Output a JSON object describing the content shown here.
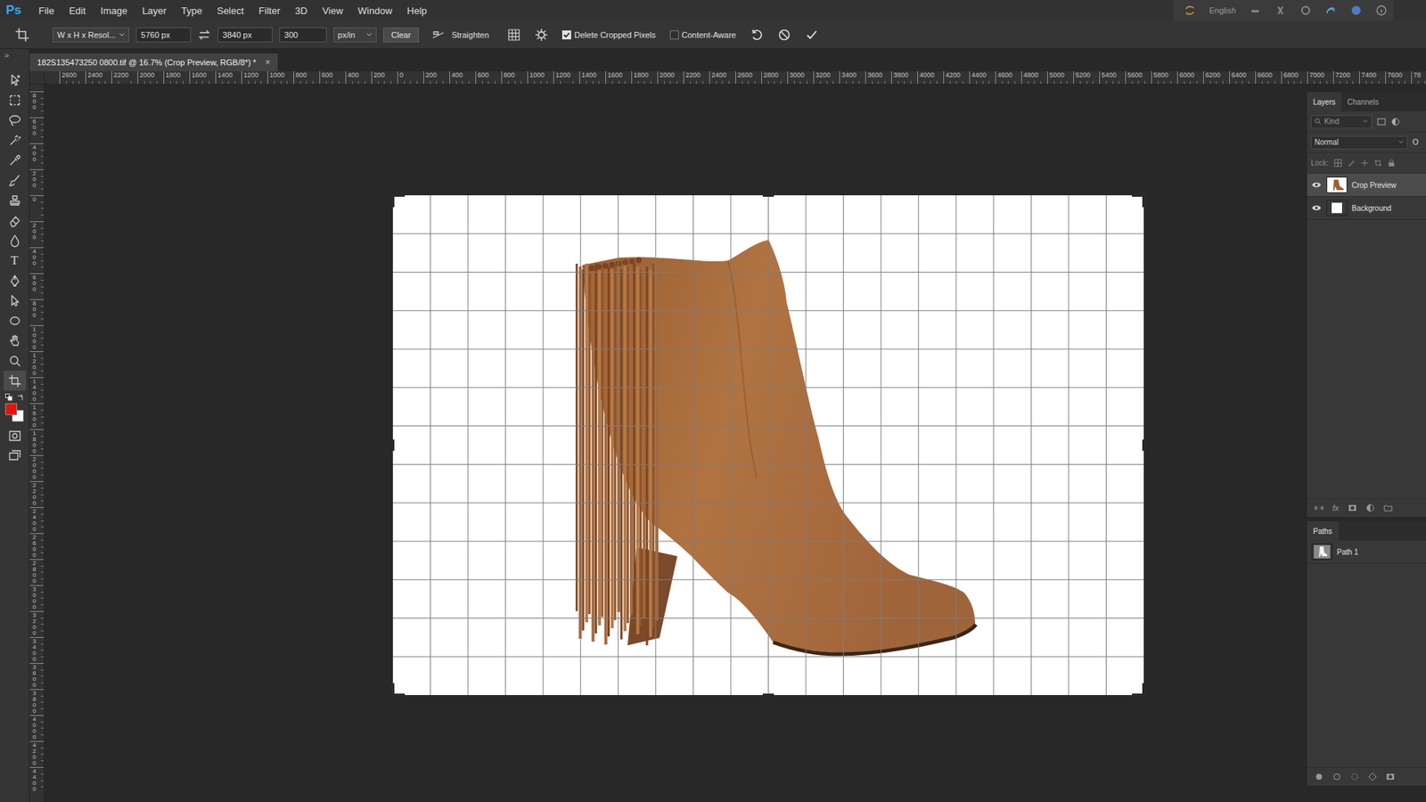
{
  "app": {
    "logo": "Ps"
  },
  "menu": [
    "File",
    "Edit",
    "Image",
    "Layer",
    "Type",
    "Select",
    "Filter",
    "3D",
    "View",
    "Window",
    "Help"
  ],
  "workspace": {
    "language": "English"
  },
  "options": {
    "preset": "W x H x Resol...",
    "width": "5760 px",
    "height": "3840 px",
    "resolution": "300",
    "unit": "px/in",
    "clear": "Clear",
    "straighten": "Straighten",
    "checkboxes": [
      {
        "label": "Delete Cropped Pixels",
        "checked": true
      },
      {
        "label": "Content-Aware",
        "checked": false
      }
    ]
  },
  "document_tab": {
    "title": "182S135473250 0800.tif @ 16.7% (Crop Preview, RGB/8*) *",
    "close": "×",
    "selected": true
  },
  "rulers": {
    "horizontal": [
      "2600",
      "2400",
      "2200",
      "2000",
      "1800",
      "1600",
      "1400",
      "1200",
      "1000",
      "800",
      "600",
      "400",
      "200",
      "0",
      "200",
      "400",
      "600",
      "800",
      "1000",
      "1200",
      "1400",
      "1600",
      "1800",
      "2000",
      "2200",
      "2400",
      "2600",
      "2800",
      "3000",
      "3200",
      "3400",
      "3600",
      "3800",
      "4000",
      "4200",
      "4400",
      "4600",
      "4800",
      "5000",
      "5200",
      "5400",
      "5600",
      "5800",
      "6000",
      "6200",
      "6400",
      "6600",
      "6800",
      "7000",
      "7200",
      "7400",
      "7600",
      "78"
    ],
    "vertical": [
      "800",
      "600",
      "400",
      "200",
      "0",
      "200",
      "400",
      "600",
      "800",
      "1000",
      "1200",
      "1400",
      "1600",
      "1800",
      "2000",
      "2200",
      "2400",
      "2600",
      "2800",
      "3000",
      "3200",
      "3400",
      "3600",
      "3800",
      "4000",
      "4200",
      "4400"
    ]
  },
  "toolbar": {
    "toggle": "»",
    "tools": [
      {
        "kind": "move",
        "selected": false
      },
      {
        "kind": "marquee",
        "selected": false
      },
      {
        "kind": "lasso",
        "selected": false
      },
      {
        "kind": "wand",
        "selected": false
      },
      {
        "kind": "eyedropper",
        "selected": false
      },
      {
        "kind": "brush",
        "selected": false
      },
      {
        "kind": "stamp",
        "selected": false
      },
      {
        "kind": "eraser",
        "selected": false
      },
      {
        "kind": "blur",
        "selected": false
      },
      {
        "kind": "type",
        "glyph": "T",
        "selected": false
      },
      {
        "kind": "pen",
        "selected": false
      },
      {
        "kind": "path",
        "selected": false
      },
      {
        "kind": "ellipse",
        "selected": false
      },
      {
        "kind": "hand",
        "selected": false
      },
      {
        "kind": "zoom",
        "selected": false
      },
      {
        "kind": "crop",
        "selected": true
      }
    ],
    "foreground": "#e8120c",
    "background": "#ffffff",
    "modes": [
      {
        "kind": "quickmask",
        "selected": false
      },
      {
        "kind": "screen",
        "selected": false
      }
    ]
  },
  "layers_panel": {
    "tabs": [
      {
        "label": "Layers",
        "selected": true
      },
      {
        "label": "Channels",
        "selected": false
      }
    ],
    "filter": "Kind",
    "blend_mode": "Normal",
    "opacity_label": "O",
    "lock_label": "Lock:",
    "fx": "fx",
    "layers": [
      {
        "name": "Crop Preview",
        "visible": true,
        "selected": true,
        "kind": "image"
      },
      {
        "name": "Background",
        "visible": true,
        "selected": false,
        "kind": "fill"
      }
    ]
  },
  "paths_panel": {
    "tabs": [
      {
        "label": "Paths",
        "selected": true
      }
    ],
    "paths": [
      {
        "name": "Path 1",
        "selected": false
      }
    ]
  }
}
